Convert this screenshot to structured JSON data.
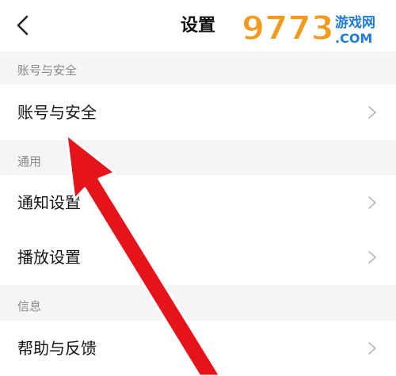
{
  "header": {
    "title": "设置",
    "watermark_number": "9773",
    "watermark_text": "游戏网",
    "watermark_domain": ".COM"
  },
  "sections": [
    {
      "title": "账号与安全",
      "items": [
        {
          "label": "账号与安全"
        }
      ]
    },
    {
      "title": "通用",
      "items": [
        {
          "label": "通知设置"
        },
        {
          "label": "播放设置"
        }
      ]
    },
    {
      "title": "信息",
      "items": [
        {
          "label": "帮助与反馈"
        }
      ]
    }
  ],
  "colors": {
    "arrow": "#e5141b",
    "section_bg": "#f5f5f5",
    "row_bg": "#ffffff"
  },
  "icons": {
    "back": "chevron-left-icon",
    "row": "chevron-right-icon"
  }
}
